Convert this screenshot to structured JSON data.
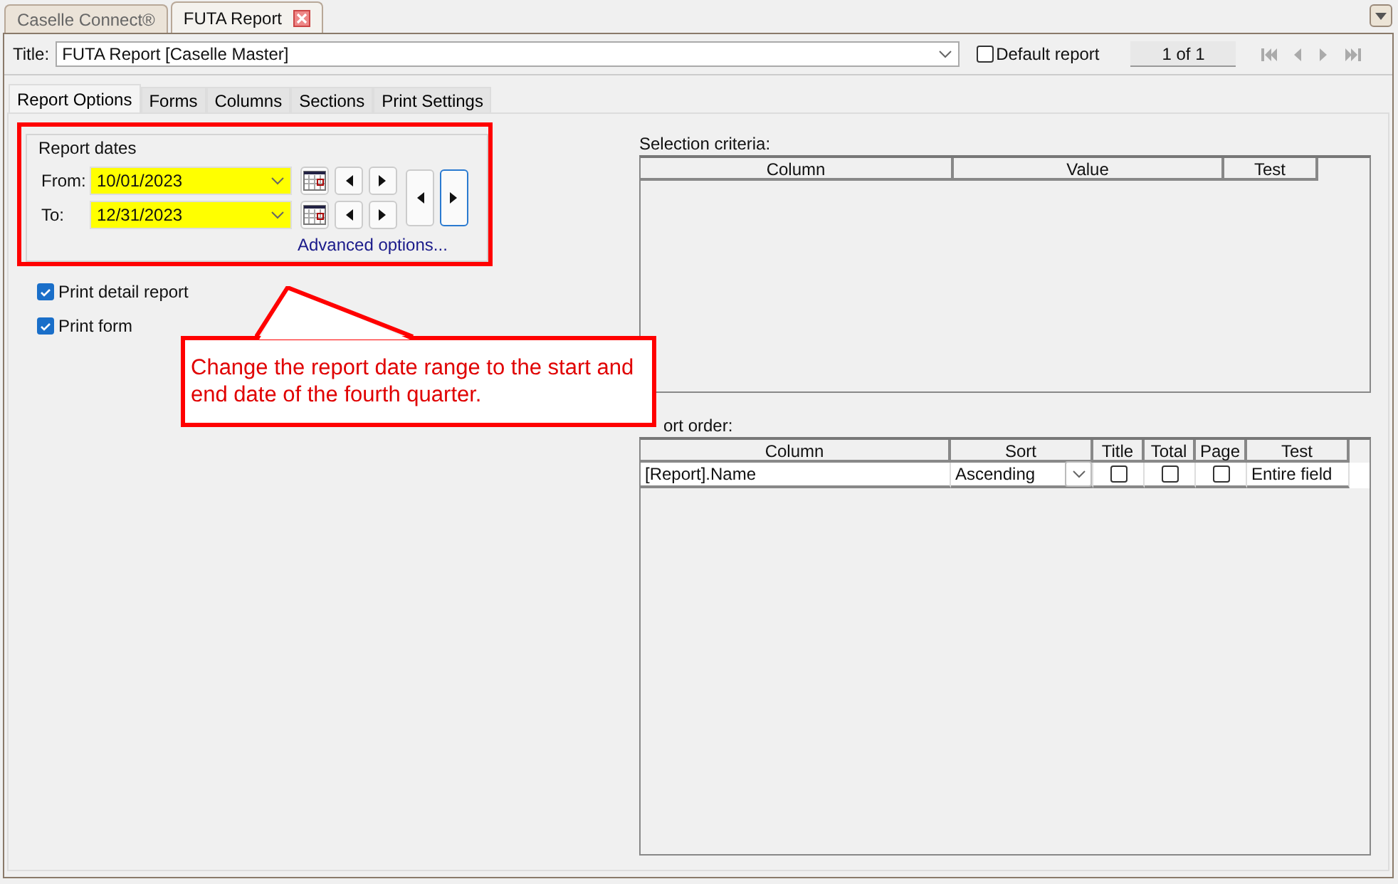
{
  "top_tabs": [
    {
      "label": "Caselle Connect®",
      "selected": false,
      "closable": false
    },
    {
      "label": "FUTA Report",
      "selected": true,
      "closable": true
    }
  ],
  "title_row": {
    "label": "Title:",
    "value": "FUTA Report [Caselle Master]",
    "default_report": {
      "label": "Default report",
      "checked": false
    },
    "page_counter": "1 of 1"
  },
  "tabs": [
    {
      "label": "Report Options",
      "selected": true
    },
    {
      "label": "Forms",
      "selected": false
    },
    {
      "label": "Columns",
      "selected": false
    },
    {
      "label": "Sections",
      "selected": false
    },
    {
      "label": "Print Settings",
      "selected": false
    }
  ],
  "report_dates": {
    "legend": "Report dates",
    "from": {
      "label": "From:",
      "value": "10/01/2023"
    },
    "to": {
      "label": "To:",
      "value": "12/31/2023"
    },
    "advanced_link": "Advanced options..."
  },
  "options": [
    {
      "label": "Print detail report",
      "checked": true
    },
    {
      "label": "Print form",
      "checked": true
    }
  ],
  "selection_criteria": {
    "label": "Selection criteria:",
    "columns": [
      "Column",
      "Value",
      "Test"
    ]
  },
  "sort_order": {
    "label": "ort order:",
    "columns": [
      "Column",
      "Sort",
      "Title",
      "Total",
      "Page",
      "Test"
    ],
    "rows": [
      {
        "column": "[Report].Name",
        "sort": "Ascending",
        "title": false,
        "total": false,
        "page": false,
        "test": "Entire field"
      }
    ]
  },
  "callout": {
    "text": "Change the report date range to the start and end date of the fourth quarter."
  }
}
